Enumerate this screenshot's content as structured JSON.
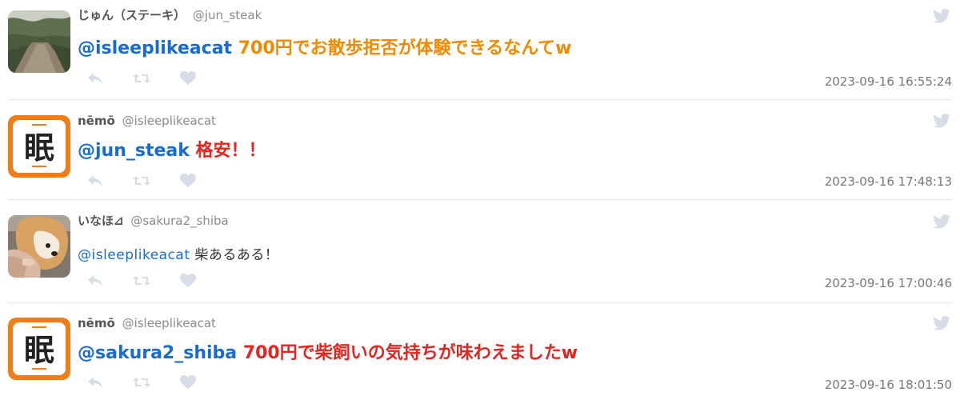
{
  "colors": {
    "mention": "#1a6bd1",
    "message_orange": "#f08a00",
    "message_red": "#e3241f",
    "name": "#555555",
    "handle": "#8a8a8a",
    "timestamp": "#777777",
    "icon": "#d6dde6",
    "divider": "#e6e6e6"
  },
  "icons": {
    "reply": "reply-icon",
    "retweet": "retweet-icon",
    "like": "heart-icon",
    "brand": "twitter-bird-icon"
  },
  "tweets": [
    {
      "avatar": "photo-path",
      "display_name": "じゅん（ステーキ）",
      "handle": "@jun_steak",
      "mention": "@isleeplikeacat",
      "message": "700円でお散歩拒否が体験できるなんてw",
      "message_style": "big-orange",
      "timestamp": "2023-09-16 16:55:24"
    },
    {
      "avatar": "logo-nemo",
      "avatar_text": "眠",
      "display_name": "nēmō",
      "handle": "@isleeplikeacat",
      "mention": "@jun_steak",
      "message": "格安！！",
      "message_style": "big-red",
      "timestamp": "2023-09-16 17:48:13"
    },
    {
      "avatar": "photo-shiba",
      "display_name": "いなほ⊿",
      "handle": "@sakura2_shiba",
      "mention": "@isleeplikeacat",
      "message": "柴あるある！",
      "message_style": "small-plain",
      "timestamp": "2023-09-16 17:00:46"
    },
    {
      "avatar": "logo-nemo",
      "avatar_text": "眠",
      "display_name": "nēmō",
      "handle": "@isleeplikeacat",
      "mention": "@sakura2_shiba",
      "message": "700円で柴飼いの気持ちが味わえましたw",
      "message_style": "big-red",
      "timestamp": "2023-09-16 18:01:50"
    }
  ]
}
